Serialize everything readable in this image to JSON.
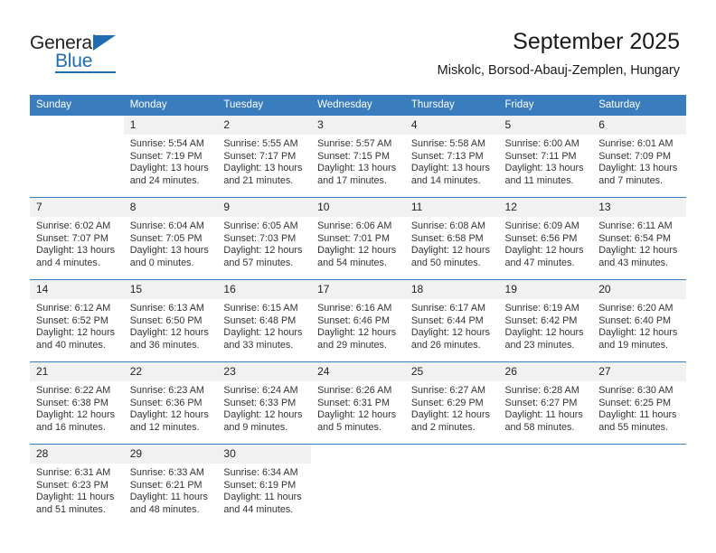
{
  "brand": {
    "name_top": "General",
    "name_bottom": "Blue",
    "accent_color": "#1f6cb0"
  },
  "header": {
    "title": "September 2025",
    "subtitle": "Miskolc, Borsod-Abauj-Zemplen, Hungary"
  },
  "calendar": {
    "header_bg": "#3a7dbf",
    "daynum_bg": "#f1f1f1",
    "weekdays": [
      "Sunday",
      "Monday",
      "Tuesday",
      "Wednesday",
      "Thursday",
      "Friday",
      "Saturday"
    ],
    "weeks": [
      [
        {
          "day": "",
          "lines": []
        },
        {
          "day": "1",
          "lines": [
            "Sunrise: 5:54 AM",
            "Sunset: 7:19 PM",
            "Daylight: 13 hours",
            "and 24 minutes."
          ]
        },
        {
          "day": "2",
          "lines": [
            "Sunrise: 5:55 AM",
            "Sunset: 7:17 PM",
            "Daylight: 13 hours",
            "and 21 minutes."
          ]
        },
        {
          "day": "3",
          "lines": [
            "Sunrise: 5:57 AM",
            "Sunset: 7:15 PM",
            "Daylight: 13 hours",
            "and 17 minutes."
          ]
        },
        {
          "day": "4",
          "lines": [
            "Sunrise: 5:58 AM",
            "Sunset: 7:13 PM",
            "Daylight: 13 hours",
            "and 14 minutes."
          ]
        },
        {
          "day": "5",
          "lines": [
            "Sunrise: 6:00 AM",
            "Sunset: 7:11 PM",
            "Daylight: 13 hours",
            "and 11 minutes."
          ]
        },
        {
          "day": "6",
          "lines": [
            "Sunrise: 6:01 AM",
            "Sunset: 7:09 PM",
            "Daylight: 13 hours",
            "and 7 minutes."
          ]
        }
      ],
      [
        {
          "day": "7",
          "lines": [
            "Sunrise: 6:02 AM",
            "Sunset: 7:07 PM",
            "Daylight: 13 hours",
            "and 4 minutes."
          ]
        },
        {
          "day": "8",
          "lines": [
            "Sunrise: 6:04 AM",
            "Sunset: 7:05 PM",
            "Daylight: 13 hours",
            "and 0 minutes."
          ]
        },
        {
          "day": "9",
          "lines": [
            "Sunrise: 6:05 AM",
            "Sunset: 7:03 PM",
            "Daylight: 12 hours",
            "and 57 minutes."
          ]
        },
        {
          "day": "10",
          "lines": [
            "Sunrise: 6:06 AM",
            "Sunset: 7:01 PM",
            "Daylight: 12 hours",
            "and 54 minutes."
          ]
        },
        {
          "day": "11",
          "lines": [
            "Sunrise: 6:08 AM",
            "Sunset: 6:58 PM",
            "Daylight: 12 hours",
            "and 50 minutes."
          ]
        },
        {
          "day": "12",
          "lines": [
            "Sunrise: 6:09 AM",
            "Sunset: 6:56 PM",
            "Daylight: 12 hours",
            "and 47 minutes."
          ]
        },
        {
          "day": "13",
          "lines": [
            "Sunrise: 6:11 AM",
            "Sunset: 6:54 PM",
            "Daylight: 12 hours",
            "and 43 minutes."
          ]
        }
      ],
      [
        {
          "day": "14",
          "lines": [
            "Sunrise: 6:12 AM",
            "Sunset: 6:52 PM",
            "Daylight: 12 hours",
            "and 40 minutes."
          ]
        },
        {
          "day": "15",
          "lines": [
            "Sunrise: 6:13 AM",
            "Sunset: 6:50 PM",
            "Daylight: 12 hours",
            "and 36 minutes."
          ]
        },
        {
          "day": "16",
          "lines": [
            "Sunrise: 6:15 AM",
            "Sunset: 6:48 PM",
            "Daylight: 12 hours",
            "and 33 minutes."
          ]
        },
        {
          "day": "17",
          "lines": [
            "Sunrise: 6:16 AM",
            "Sunset: 6:46 PM",
            "Daylight: 12 hours",
            "and 29 minutes."
          ]
        },
        {
          "day": "18",
          "lines": [
            "Sunrise: 6:17 AM",
            "Sunset: 6:44 PM",
            "Daylight: 12 hours",
            "and 26 minutes."
          ]
        },
        {
          "day": "19",
          "lines": [
            "Sunrise: 6:19 AM",
            "Sunset: 6:42 PM",
            "Daylight: 12 hours",
            "and 23 minutes."
          ]
        },
        {
          "day": "20",
          "lines": [
            "Sunrise: 6:20 AM",
            "Sunset: 6:40 PM",
            "Daylight: 12 hours",
            "and 19 minutes."
          ]
        }
      ],
      [
        {
          "day": "21",
          "lines": [
            "Sunrise: 6:22 AM",
            "Sunset: 6:38 PM",
            "Daylight: 12 hours",
            "and 16 minutes."
          ]
        },
        {
          "day": "22",
          "lines": [
            "Sunrise: 6:23 AM",
            "Sunset: 6:36 PM",
            "Daylight: 12 hours",
            "and 12 minutes."
          ]
        },
        {
          "day": "23",
          "lines": [
            "Sunrise: 6:24 AM",
            "Sunset: 6:33 PM",
            "Daylight: 12 hours",
            "and 9 minutes."
          ]
        },
        {
          "day": "24",
          "lines": [
            "Sunrise: 6:26 AM",
            "Sunset: 6:31 PM",
            "Daylight: 12 hours",
            "and 5 minutes."
          ]
        },
        {
          "day": "25",
          "lines": [
            "Sunrise: 6:27 AM",
            "Sunset: 6:29 PM",
            "Daylight: 12 hours",
            "and 2 minutes."
          ]
        },
        {
          "day": "26",
          "lines": [
            "Sunrise: 6:28 AM",
            "Sunset: 6:27 PM",
            "Daylight: 11 hours",
            "and 58 minutes."
          ]
        },
        {
          "day": "27",
          "lines": [
            "Sunrise: 6:30 AM",
            "Sunset: 6:25 PM",
            "Daylight: 11 hours",
            "and 55 minutes."
          ]
        }
      ],
      [
        {
          "day": "28",
          "lines": [
            "Sunrise: 6:31 AM",
            "Sunset: 6:23 PM",
            "Daylight: 11 hours",
            "and 51 minutes."
          ]
        },
        {
          "day": "29",
          "lines": [
            "Sunrise: 6:33 AM",
            "Sunset: 6:21 PM",
            "Daylight: 11 hours",
            "and 48 minutes."
          ]
        },
        {
          "day": "30",
          "lines": [
            "Sunrise: 6:34 AM",
            "Sunset: 6:19 PM",
            "Daylight: 11 hours",
            "and 44 minutes."
          ]
        },
        {
          "day": "",
          "lines": []
        },
        {
          "day": "",
          "lines": []
        },
        {
          "day": "",
          "lines": []
        },
        {
          "day": "",
          "lines": []
        }
      ]
    ]
  }
}
